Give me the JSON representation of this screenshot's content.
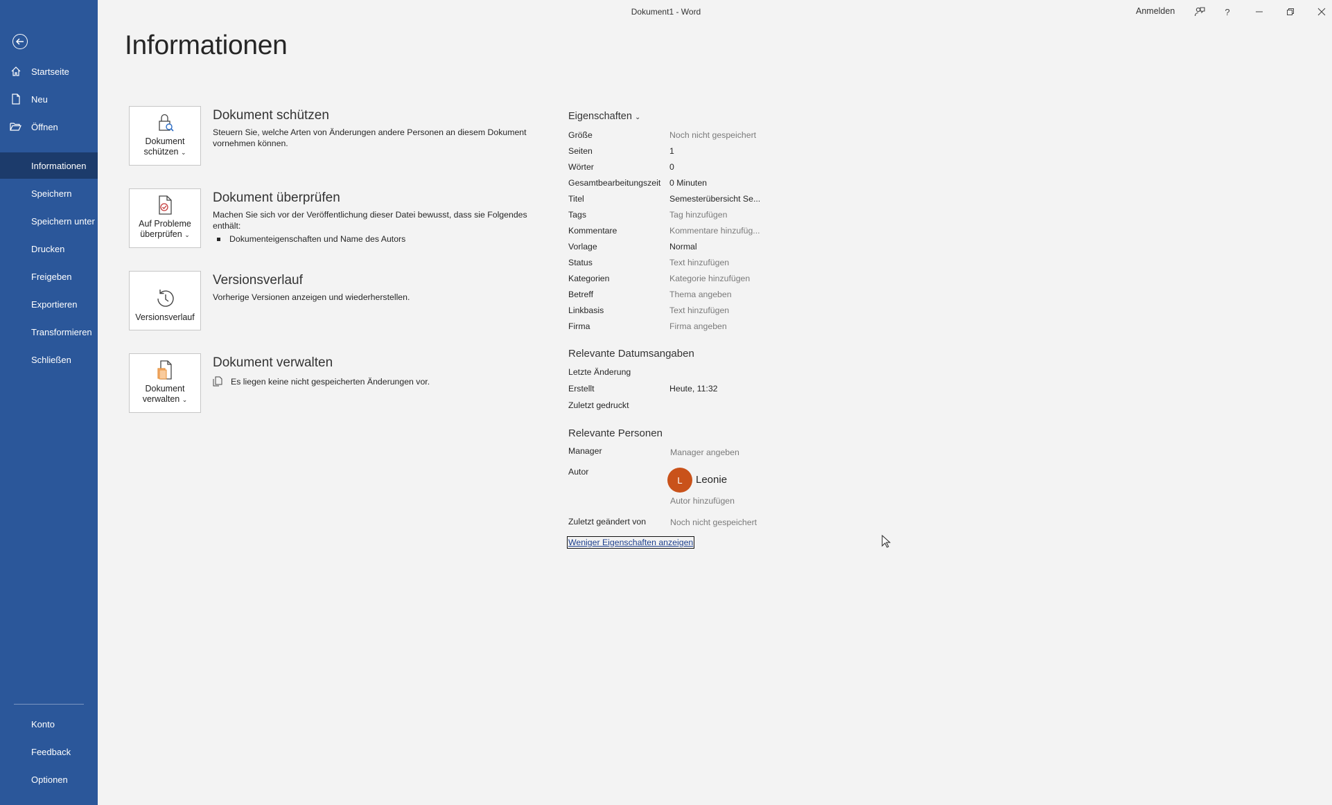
{
  "window": {
    "title": "Dokument1 - Word",
    "signin": "Anmelden",
    "help": "?"
  },
  "nav": {
    "items": [
      {
        "label": "Startseite",
        "icon": "home-icon"
      },
      {
        "label": "Neu",
        "icon": "new-document-icon"
      },
      {
        "label": "Öffnen",
        "icon": "folder-open-icon"
      },
      {
        "label": "Informationen",
        "active": true
      },
      {
        "label": "Speichern"
      },
      {
        "label": "Speichern unter"
      },
      {
        "label": "Drucken"
      },
      {
        "label": "Freigeben"
      },
      {
        "label": "Exportieren"
      },
      {
        "label": "Transformieren"
      },
      {
        "label": "Schließen"
      }
    ],
    "bottom": [
      {
        "label": "Konto"
      },
      {
        "label": "Feedback"
      },
      {
        "label": "Optionen"
      }
    ]
  },
  "page_title": "Informationen",
  "sections": [
    {
      "button_line1": "Dokument",
      "button_line2": "schützen",
      "heading": "Dokument schützen",
      "description": "Steuern Sie, welche Arten von Änderungen andere Personen an diesem Dokument vornehmen können."
    },
    {
      "button_line1": "Auf Probleme",
      "button_line2": "überprüfen",
      "heading": "Dokument überprüfen",
      "description": "Machen Sie sich vor der Veröffentlichung dieser Datei bewusst, dass sie Folgendes enthält:",
      "bullet": "Dokumenteigenschaften und Name des Autors"
    },
    {
      "button_line1": "Versionsverlauf",
      "heading": "Versionsverlauf",
      "description": "Vorherige Versionen anzeigen und wiederherstellen."
    },
    {
      "button_line1": "Dokument",
      "button_line2": "verwalten",
      "heading": "Dokument verwalten",
      "description": "Es liegen keine nicht gespeicherten Änderungen vor."
    }
  ],
  "properties": {
    "title": "Eigenschaften",
    "rows": [
      {
        "key": "Größe",
        "value": "Noch nicht gespeichert",
        "placeholder": true
      },
      {
        "key": "Seiten",
        "value": "1"
      },
      {
        "key": "Wörter",
        "value": "0"
      },
      {
        "key": "Gesamtbearbeitungszeit",
        "value": "0 Minuten"
      },
      {
        "key": "Titel",
        "value": "Semesterübersicht Se..."
      },
      {
        "key": "Tags",
        "value": "Tag hinzufügen",
        "placeholder": true
      },
      {
        "key": "Kommentare",
        "value": "Kommentare hinzufüg...",
        "placeholder": true
      },
      {
        "key": "Vorlage",
        "value": "Normal"
      },
      {
        "key": "Status",
        "value": "Text hinzufügen",
        "placeholder": true
      },
      {
        "key": "Kategorien",
        "value": "Kategorie hinzufügen",
        "placeholder": true
      },
      {
        "key": "Betreff",
        "value": "Thema angeben",
        "placeholder": true
      },
      {
        "key": "Linkbasis",
        "value": "Text hinzufügen",
        "placeholder": true
      },
      {
        "key": "Firma",
        "value": "Firma angeben",
        "placeholder": true
      }
    ]
  },
  "dates": {
    "title": "Relevante Datumsangaben",
    "rows": [
      {
        "key": "Letzte Änderung",
        "value": ""
      },
      {
        "key": "Erstellt",
        "value": "Heute, 11:32"
      },
      {
        "key": "Zuletzt gedruckt",
        "value": ""
      }
    ]
  },
  "people": {
    "title": "Relevante Personen",
    "manager_key": "Manager",
    "manager_value": "Manager angeben",
    "author_key": "Autor",
    "author_initial": "L",
    "author_name": "Leonie",
    "add_author": "Autor hinzufügen",
    "last_modified_key": "Zuletzt geändert von",
    "last_modified_value": "Noch nicht gespeichert"
  },
  "less_properties_link": "Weniger Eigenschaften anzeigen",
  "colors": {
    "nav_bg": "#2b579a",
    "nav_active": "#1c3b6b",
    "avatar": "#c9521a",
    "link": "#1b3e8c"
  }
}
